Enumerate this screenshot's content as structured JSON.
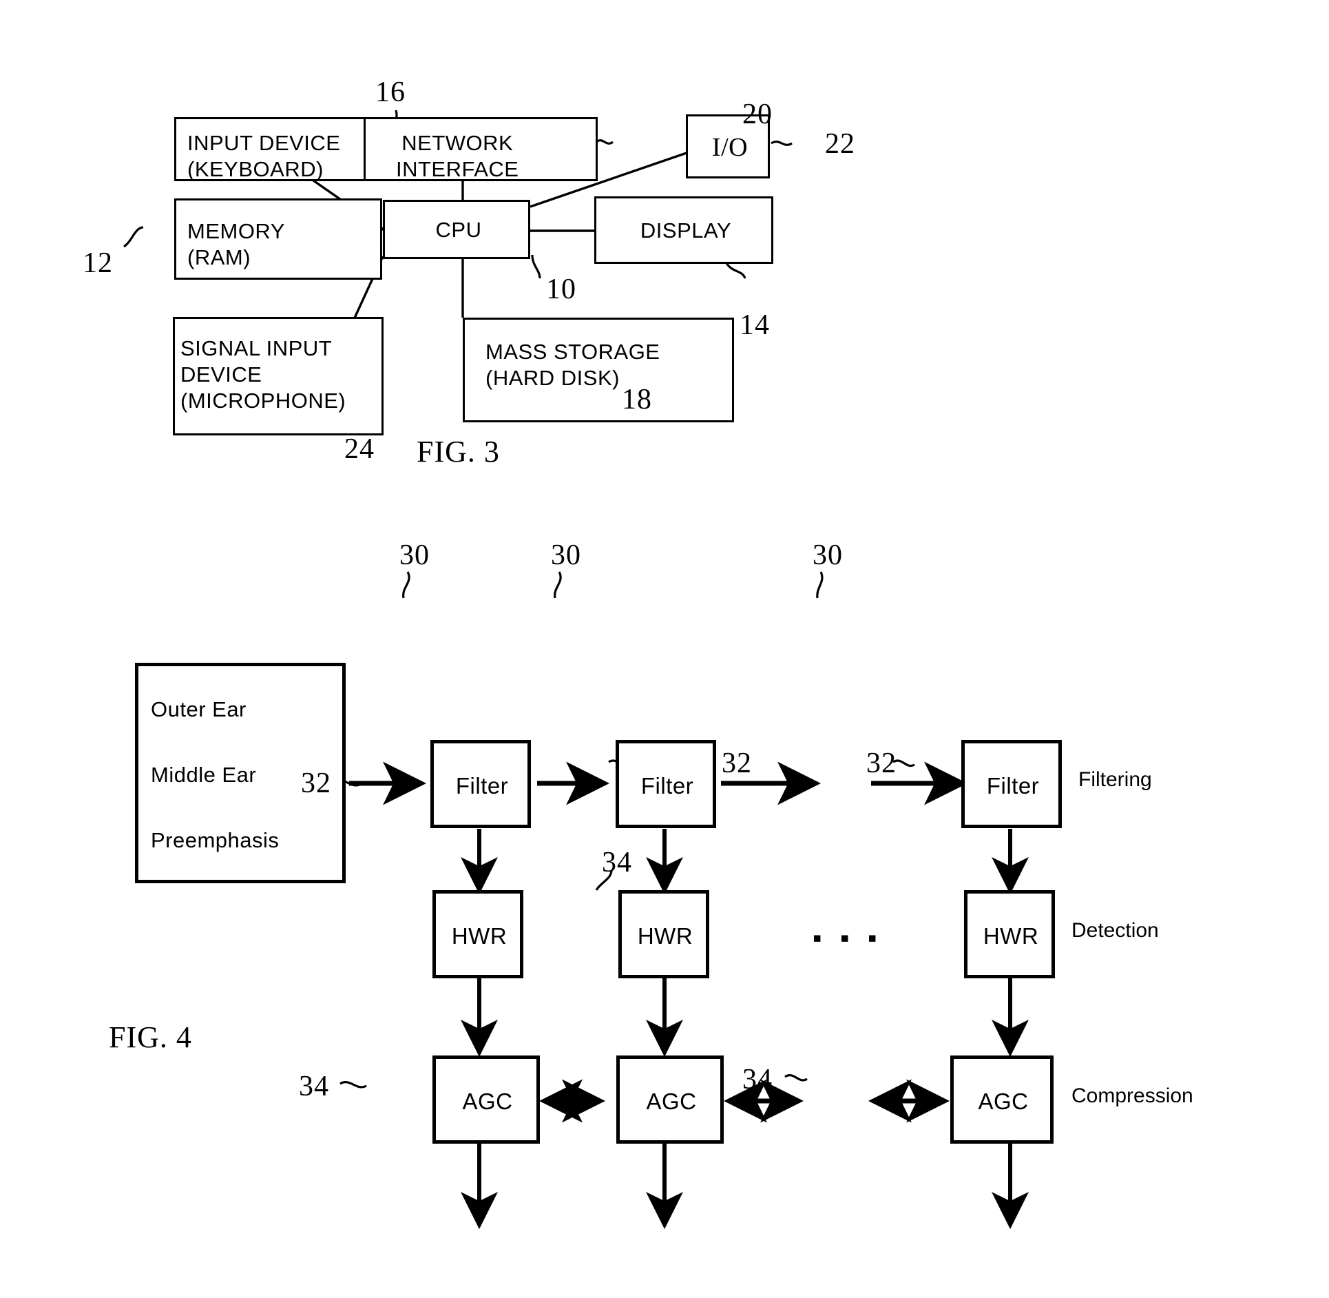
{
  "figures": [
    {
      "id": "fig3",
      "caption": "FIG. 3",
      "boxes": {
        "input_device": "INPUT DEVICE\n(KEYBOARD)",
        "network_interface": "NETWORK\nINTERFACE",
        "io": "I/O",
        "memory": "MEMORY\n(RAM)",
        "cpu": "CPU",
        "display": "DISPLAY",
        "signal_input_device": "SIGNAL INPUT\nDEVICE\n(MICROPHONE)",
        "mass_storage": "MASS STORAGE\n(HARD DISK)"
      },
      "reference_numerals": {
        "input_device": "16",
        "network_interface": "20",
        "io": "22",
        "memory": "12",
        "cpu": "10",
        "display": "14",
        "signal_input_device": "24",
        "mass_storage": "18"
      }
    },
    {
      "id": "fig4",
      "caption": "FIG. 4",
      "stage_box": {
        "line1": "Outer Ear",
        "line2": "Middle Ear",
        "line3": "Preemphasis"
      },
      "rows": [
        {
          "name": "filtering",
          "block_label": "Filter",
          "row_label": "Filtering",
          "numeral": "30",
          "blocks": [
            "Filter",
            "Filter",
            "Filter"
          ],
          "numerals": [
            "30",
            "30",
            "30"
          ]
        },
        {
          "name": "detection",
          "block_label": "HWR",
          "row_label": "Detection",
          "numeral": "32",
          "blocks": [
            "HWR",
            "HWR",
            "HWR"
          ],
          "numerals": [
            "32",
            "32",
            "32"
          ]
        },
        {
          "name": "compression",
          "block_label": "AGC",
          "row_label": "Compression",
          "numeral": "34",
          "blocks": [
            "AGC",
            "AGC",
            "AGC"
          ],
          "numerals": [
            "34",
            "34",
            "34"
          ]
        }
      ],
      "ellipsis": "▪ ▪ ▪"
    }
  ],
  "fig3": {
    "caption": "FIG. 3",
    "input_device": "INPUT DEVICE\n(KEYBOARD)",
    "network_interface": "NETWORK\nINTERFACE",
    "io": "I/O",
    "memory": "MEMORY\n(RAM)",
    "cpu": "CPU",
    "display": "DISPLAY",
    "signal_input_device": "SIGNAL INPUT\nDEVICE\n(MICROPHONE)",
    "mass_storage": "MASS STORAGE\n(HARD DISK)",
    "num_16": "16",
    "num_20": "20",
    "num_22": "22",
    "num_12": "12",
    "num_10": "10",
    "num_14": "14",
    "num_24": "24",
    "num_18": "18"
  },
  "fig4": {
    "caption": "FIG. 4",
    "stage_line1": "Outer Ear",
    "stage_line2": "Middle Ear",
    "stage_line3": "Preemphasis",
    "filter1": "Filter",
    "filter2": "Filter",
    "filter3": "Filter",
    "hwr1": "HWR",
    "hwr2": "HWR",
    "hwr3": "HWR",
    "agc1": "AGC",
    "agc2": "AGC",
    "agc3": "AGC",
    "label_filtering": "Filtering",
    "label_detection": "Detection",
    "label_compression": "Compression",
    "num_30_a": "30",
    "num_30_b": "30",
    "num_30_c": "30",
    "num_32_a": "32",
    "num_32_b": "32",
    "num_32_c": "32",
    "num_34_a": "34",
    "num_34_b": "34",
    "num_34_c": "34",
    "ellipsis": "▪ ▪ ▪"
  },
  "colors": {
    "ink": "#000000",
    "paper": "#ffffff"
  }
}
